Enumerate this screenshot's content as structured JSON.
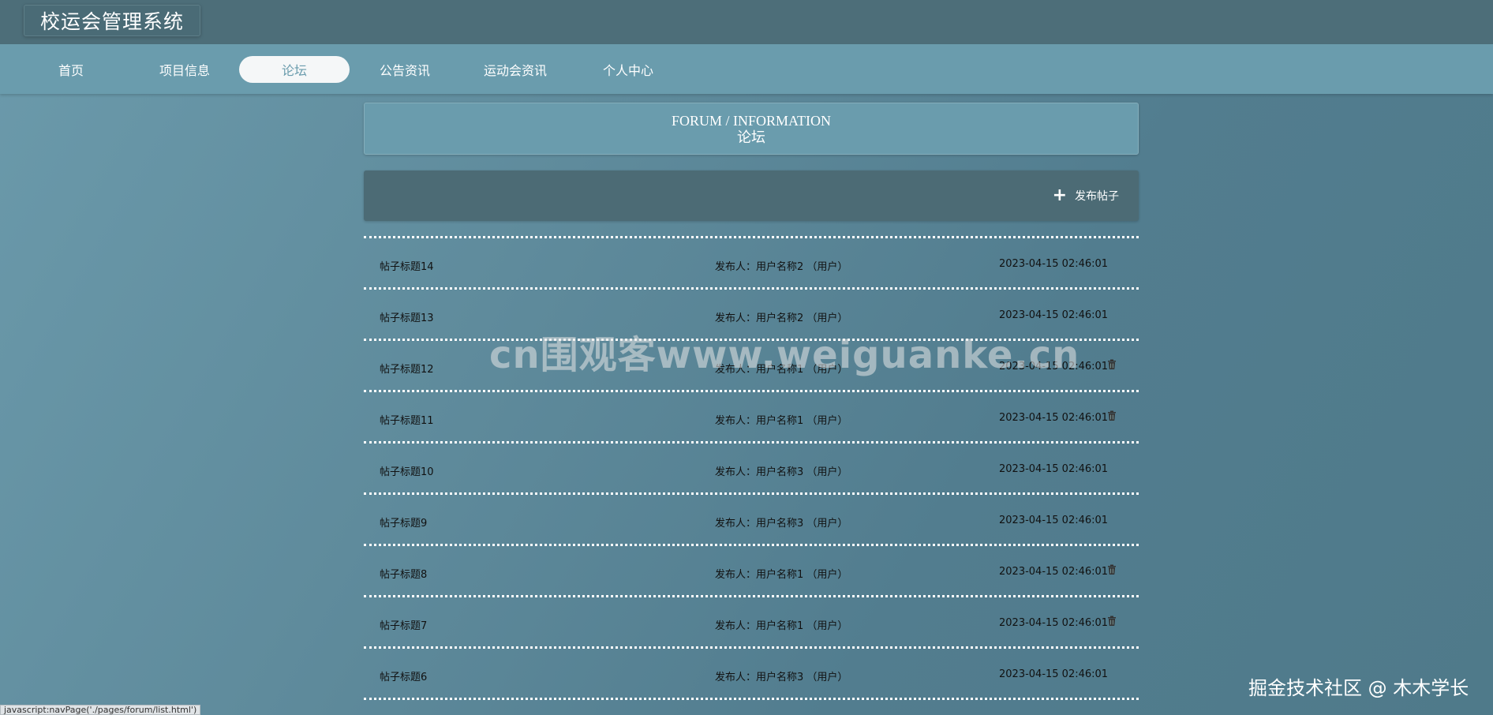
{
  "app": {
    "title": "校运会管理系统"
  },
  "nav": {
    "items": [
      {
        "label": "首页"
      },
      {
        "label": "项目信息"
      },
      {
        "label": "论坛"
      },
      {
        "label": "公告资讯"
      },
      {
        "label": "运动会资讯"
      },
      {
        "label": "个人中心"
      }
    ],
    "active": "论坛"
  },
  "page": {
    "title_en": "FORUM / INFORMATION",
    "title_cn": "论坛"
  },
  "actions": {
    "publish_icon": "+",
    "publish_label": "发布帖子"
  },
  "posts": [
    {
      "title": "帖子标题14",
      "author": "发布人：用户名称2 （用户）",
      "time": "2023-04-15 02:46:01",
      "deletable": false
    },
    {
      "title": "帖子标题13",
      "author": "发布人：用户名称2 （用户）",
      "time": "2023-04-15 02:46:01",
      "deletable": false
    },
    {
      "title": "帖子标题12",
      "author": "发布人：用户名称1 （用户）",
      "time": "2023-04-15 02:46:01",
      "deletable": true
    },
    {
      "title": "帖子标题11",
      "author": "发布人：用户名称1 （用户）",
      "time": "2023-04-15 02:46:01",
      "deletable": true
    },
    {
      "title": "帖子标题10",
      "author": "发布人：用户名称3 （用户）",
      "time": "2023-04-15 02:46:01",
      "deletable": false
    },
    {
      "title": "帖子标题9",
      "author": "发布人：用户名称3 （用户）",
      "time": "2023-04-15 02:46:01",
      "deletable": false
    },
    {
      "title": "帖子标题8",
      "author": "发布人：用户名称1 （用户）",
      "time": "2023-04-15 02:46:01",
      "deletable": true
    },
    {
      "title": "帖子标题7",
      "author": "发布人：用户名称1 （用户）",
      "time": "2023-04-15 02:46:01",
      "deletable": true
    },
    {
      "title": "帖子标题6",
      "author": "发布人：用户名称3 （用户）",
      "time": "2023-04-15 02:46:01",
      "deletable": false
    }
  ],
  "watermarks": {
    "center": "cn围观客www.weiguanke.cn",
    "corner": "掘金技术社区 @ 木木学长"
  },
  "status_bar": {
    "url": "javascript:navPage('./pages/forum/list.html')"
  },
  "colors": {
    "topbar": "#4d6e79",
    "navbar": "#6a9cad",
    "action_bar": "#4c6b75",
    "active_tab": "#f5f7f8"
  },
  "icons": {
    "delete": "trash-icon",
    "publish": "plus-icon"
  }
}
